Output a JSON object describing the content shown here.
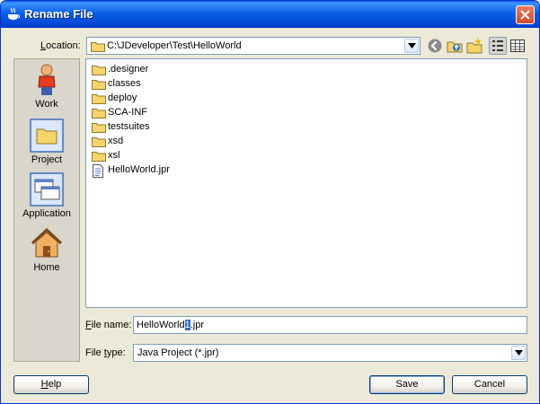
{
  "window": {
    "title": "Rename File"
  },
  "location": {
    "label_accel": "L",
    "label_rest": "ocation:",
    "path": "C:\\JDeveloper\\Test\\HelloWorld"
  },
  "toolbar": {
    "icons": [
      "back-icon",
      "up-folder-icon",
      "new-folder-icon",
      "list-view-icon",
      "details-view-icon"
    ]
  },
  "places": [
    {
      "label": "Work",
      "icon": "work-person-icon"
    },
    {
      "label": "Project",
      "icon": "project-folder-icon"
    },
    {
      "label": "Application",
      "icon": "application-icon"
    },
    {
      "label": "Home",
      "icon": "home-icon"
    }
  ],
  "files": [
    {
      "name": ".designer",
      "type": "folder"
    },
    {
      "name": "classes",
      "type": "folder"
    },
    {
      "name": "deploy",
      "type": "folder"
    },
    {
      "name": "SCA-INF",
      "type": "folder"
    },
    {
      "name": "testsuites",
      "type": "folder"
    },
    {
      "name": "xsd",
      "type": "folder"
    },
    {
      "name": "xsl",
      "type": "folder"
    },
    {
      "name": "HelloWorld.jpr",
      "type": "file"
    }
  ],
  "file_name": {
    "label_accel": "F",
    "label_rest": "ile name:",
    "value_before": "HelloWorld",
    "value_selected": "1",
    "value_after": ".jpr"
  },
  "file_type": {
    "label_pre": "File ",
    "label_accel": "t",
    "label_rest": "ype:",
    "value": "Java Project (*.jpr)"
  },
  "buttons": {
    "help_accel": "H",
    "help_rest": "elp",
    "save": "Save",
    "cancel": "Cancel"
  },
  "colors": {
    "titlebar": "#0a5fe6",
    "selection": "#316ac5",
    "folder": "#f5d46a",
    "dialog_bg": "#ece9d8"
  }
}
